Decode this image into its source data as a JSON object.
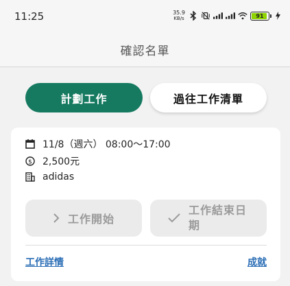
{
  "status_bar": {
    "time": "11:25",
    "net_speed_value": "35.9",
    "net_speed_unit": "KB/s",
    "battery_level": "91",
    "battery_color": "#8fd400"
  },
  "header": {
    "title": "確認名單"
  },
  "tabs": {
    "planned_label": "計劃工作",
    "past_label": "過往工作清單",
    "active_color": "#157a60"
  },
  "job_card": {
    "date_icon": "calendar-icon",
    "date_text": "11/8（週六） 08:00〜17:00",
    "pay_icon": "dollar-coin-icon",
    "pay_text": "2,500元",
    "company_icon": "building-icon",
    "company_text": "adidas",
    "start_button_label": "工作開始",
    "start_button_icon": "chevron-right-icon",
    "end_button_label": "工作結束日期",
    "end_button_icon": "checkmark-icon",
    "details_link": "工作詳情",
    "achievement_link": "成就",
    "link_color": "#2a6db5"
  }
}
